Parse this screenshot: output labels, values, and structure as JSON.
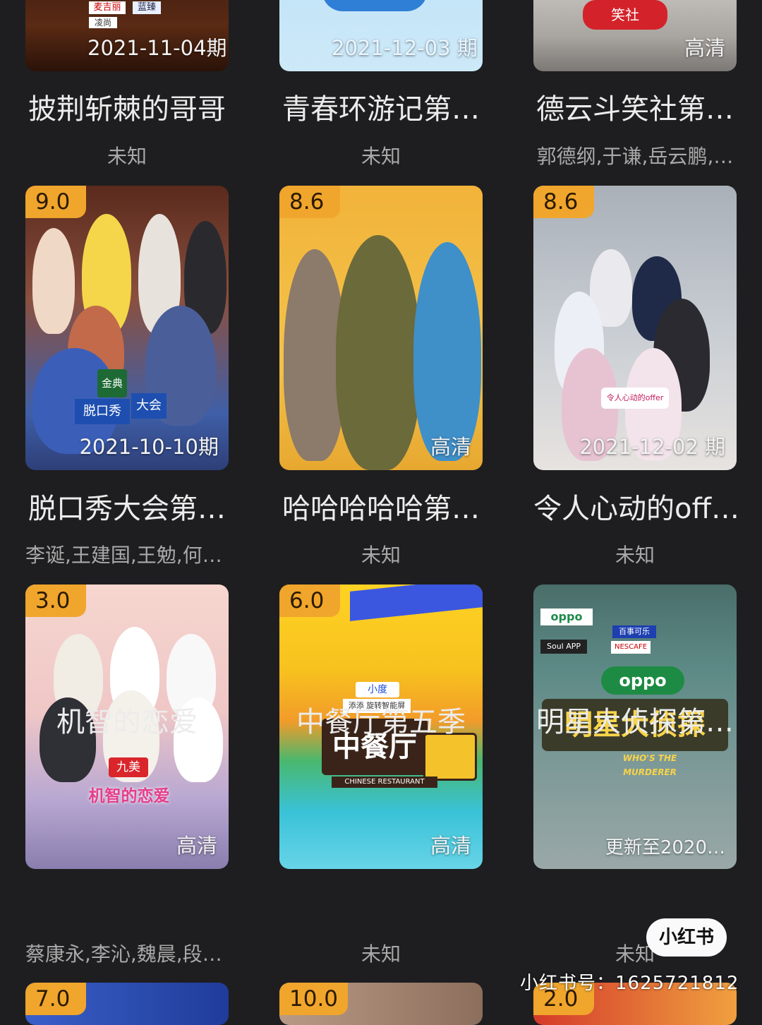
{
  "cards": [
    {
      "poster_date": "2021-11-04期",
      "title": "披荆斩棘的哥哥",
      "sub": "未知",
      "rating": ""
    },
    {
      "poster_date": "2021-12-03 期",
      "title": "青春环游记第…",
      "sub": "未知",
      "rating": ""
    },
    {
      "poster_date": "高清",
      "title": "德云斗笑社第…",
      "sub": "郭德纲,于谦,岳云鹏,…",
      "rating": ""
    },
    {
      "poster_date": "2021-10-10期",
      "title": "脱口秀大会第…",
      "sub": "李诞,王建国,王勉,何…",
      "rating": "9.0"
    },
    {
      "poster_date": "高清",
      "title": "哈哈哈哈哈第…",
      "sub": "未知",
      "rating": "8.6"
    },
    {
      "poster_date": "2021-12-02 期",
      "title": "令人心动的off…",
      "sub": "未知",
      "rating": "8.6"
    },
    {
      "poster_date": "高清",
      "title": "机智的恋爱",
      "sub": "蔡康永,李沁,魏晨,段…",
      "rating": "3.0"
    },
    {
      "poster_date": "高清",
      "title": "中餐厅第五季",
      "sub": "未知",
      "rating": "6.0"
    },
    {
      "poster_date": "更新至2020…",
      "title": "明星大侦探第…",
      "sub": "未知",
      "rating": ""
    },
    {
      "rating": "7.0"
    },
    {
      "rating": "10.0"
    },
    {
      "rating": "2.0"
    }
  ],
  "poster_art": {
    "c0_brand1": "麦吉丽",
    "c0_brand2": "蓝臻",
    "c0_brand3": "凌尚",
    "c2_logo": "笑社",
    "c3_logo1": "金典",
    "c3_logo2": "脱口秀",
    "c3_logo3": "大会",
    "c5_logo": "令人心动的offer",
    "c6_brand": "九美",
    "c6_logo": "机智的恋爱",
    "c7_logo": "中餐厅",
    "c7_brand": "小度",
    "c7_sub": "添添 旋转智能屏",
    "c7_en": "CHINESE RESTAURANT",
    "c8_brand": "oppo",
    "c8_logo": "明星大侦探",
    "c8_en": "WHO'S THE MURDERER",
    "c8_sponsor1": "百事可乐",
    "c8_sponsor2": "Soul APP",
    "c8_sponsor3": "NESCAFE"
  },
  "watermark": {
    "badge": "小红书",
    "text": "小红书号：1625721812"
  },
  "colors": {
    "background": "#1e1e20",
    "rating_badge": "#f0a52c"
  }
}
